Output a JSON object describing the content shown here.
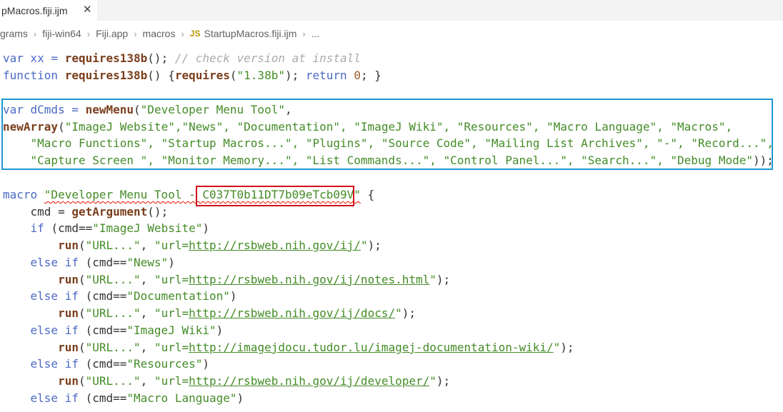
{
  "tab": {
    "title": "pMacros.fiji.ijm",
    "close_glyph": "✕"
  },
  "breadcrumb": {
    "items": [
      "grams",
      "fiji-win64",
      "Fiji.app",
      "macros"
    ],
    "file_icon": "JS",
    "file": "StartupMacros.fiji.ijm",
    "more": "..."
  },
  "code": {
    "l1": {
      "a": "var xx = ",
      "b": "requires138b",
      "c": "(); ",
      "d": "// check version at install"
    },
    "l2": {
      "a": "function ",
      "b": "requires138b",
      "c": "() {",
      "d": "requires",
      "e": "(",
      "f": "\"1.38b\"",
      "g": "); ",
      "h": "return ",
      "i": "0",
      "j": "; }"
    },
    "l4": {
      "a": "var dCmds = ",
      "b": "newMenu",
      "c": "(",
      "d": "\"Developer Menu Tool\"",
      "e": ","
    },
    "l5": {
      "a": "newArray",
      "b": "(",
      "c": "\"ImageJ Website\",\"News\", \"Documentation\", \"ImageJ Wiki\", \"Resources\", \"Macro Language\", \"Macros\","
    },
    "l6": {
      "a": "    \"Macro Functions\", \"Startup Macros...\", \"Plugins\", \"Source Code\", \"Mailing List Archives\", \"-\", \"Record...\","
    },
    "l7": {
      "a": "    \"Capture Screen \", \"Monitor Memory...\", \"List Commands...\", \"Control Panel...\", \"Search...\", \"Debug Mode\"",
      "b": "));"
    },
    "l9": {
      "a": "macro ",
      "b": "\"Developer Menu Tool - C037T0b11DT7b09eTcb09V\"",
      "c": " {"
    },
    "l10": {
      "a": "    cmd = ",
      "b": "getArgument",
      "c": "();"
    },
    "l11": {
      "a": "    if ",
      "b": "(cmd==",
      "c": "\"ImageJ Website\"",
      "d": ")"
    },
    "l12": {
      "a": "        ",
      "b": "run",
      "c": "(",
      "d": "\"URL...\"",
      "e": ", ",
      "f": "\"url=",
      "g": "http://rsbweb.nih.gov/ij/",
      "h": "\"",
      "i": ");"
    },
    "l13": {
      "a": "    else if ",
      "b": "(cmd==",
      "c": "\"News\"",
      "d": ")"
    },
    "l14": {
      "a": "        ",
      "b": "run",
      "c": "(",
      "d": "\"URL...\"",
      "e": ", ",
      "f": "\"url=",
      "g": "http://rsbweb.nih.gov/ij/notes.html",
      "h": "\"",
      "i": ");"
    },
    "l15": {
      "a": "    else if ",
      "b": "(cmd==",
      "c": "\"Documentation\"",
      "d": ")"
    },
    "l16": {
      "a": "        ",
      "b": "run",
      "c": "(",
      "d": "\"URL...\"",
      "e": ", ",
      "f": "\"url=",
      "g": "http://rsbweb.nih.gov/ij/docs/",
      "h": "\"",
      "i": ");"
    },
    "l17": {
      "a": "    else if ",
      "b": "(cmd==",
      "c": "\"ImageJ Wiki\"",
      "d": ")"
    },
    "l18": {
      "a": "        ",
      "b": "run",
      "c": "(",
      "d": "\"URL...\"",
      "e": ", ",
      "f": "\"url=",
      "g": "http://imagejdocu.tudor.lu/imagej-documentation-wiki/",
      "h": "\"",
      "i": ");"
    },
    "l19": {
      "a": "    else if ",
      "b": "(cmd==",
      "c": "\"Resources\"",
      "d": ")"
    },
    "l20": {
      "a": "        ",
      "b": "run",
      "c": "(",
      "d": "\"URL...\"",
      "e": ", ",
      "f": "\"url=",
      "g": "http://rsbweb.nih.gov/ij/developer/",
      "h": "\"",
      "i": ");"
    },
    "l21": {
      "a": "    else if ",
      "b": "(cmd==",
      "c": "\"Macro Language\"",
      "d": ")"
    }
  },
  "colors": {
    "keyword": "#4b69c6",
    "function": "#7a3e1d",
    "string": "#448c27",
    "comment": "#aaaaaa",
    "highlight_blue": "#1a97d5",
    "highlight_red": "#d0101c"
  }
}
